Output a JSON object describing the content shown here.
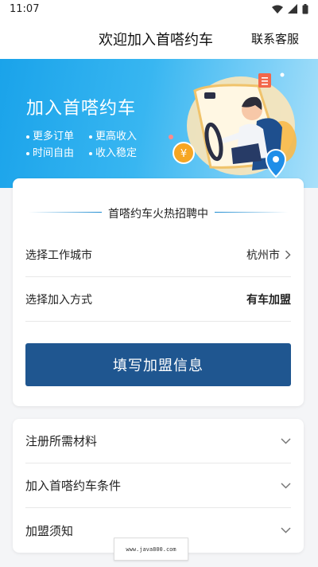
{
  "status_bar": {
    "time": "11:07"
  },
  "header": {
    "title": "欢迎加入首嗒约车",
    "service": "联系客服"
  },
  "banner": {
    "title": "加入首嗒约车",
    "features": [
      "更多订单",
      "更高收入",
      "时间自由",
      "收入稳定"
    ],
    "coin_symbol": "¥"
  },
  "recruit": {
    "heading": "首嗒约车火热招聘中",
    "rows": [
      {
        "label": "选择工作城市",
        "value": "杭州市"
      },
      {
        "label": "选择加入方式",
        "value": "有车加盟"
      }
    ],
    "submit_label": "填写加盟信息"
  },
  "faq": {
    "items": [
      {
        "label": "注册所需材料"
      },
      {
        "label": "加入首嗒约车条件"
      },
      {
        "label": "加盟须知"
      }
    ]
  },
  "watermark": "www.java800.com",
  "colors": {
    "accent": "#1f5690",
    "banner_blue": "#1aa3ea",
    "coin_orange": "#f6a623"
  },
  "icons": [
    "wifi-icon",
    "signal-icon",
    "battery-icon",
    "chevron-right-icon",
    "chevron-down-icon",
    "location-pin-icon",
    "coin-icon",
    "document-icon"
  ]
}
